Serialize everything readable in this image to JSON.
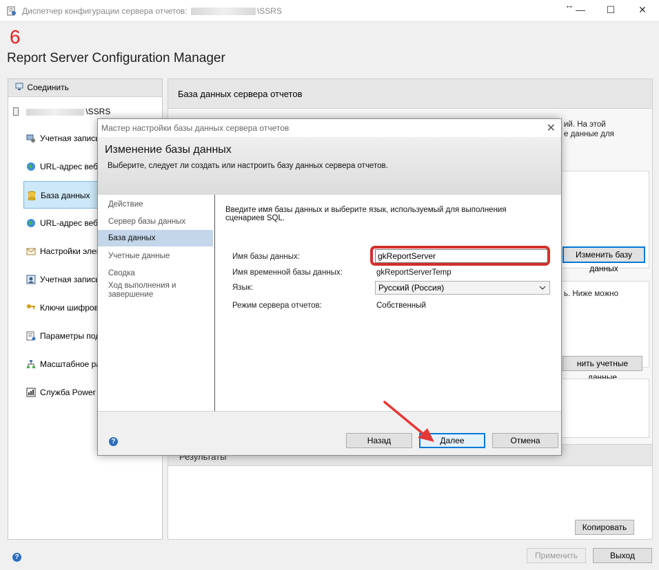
{
  "window": {
    "title_prefix": "Диспетчер конфигурации сервера отчетов:",
    "title_suffix": "\\SSRS",
    "resize_glyph": "↔",
    "minimize": "—",
    "maximize": "☐",
    "close": "✕"
  },
  "step_number": "6",
  "app_title": "Report Server Configuration Manager",
  "left_panel": {
    "connect_label": "Соединить",
    "connect_underline": "С",
    "server_suffix": "\\SSRS",
    "nav_items": [
      {
        "label": "Учетная запись службы",
        "icon": "service-account-icon"
      },
      {
        "label": "URL-адрес веб-службы",
        "icon": "web-service-url-icon"
      },
      {
        "label": "База данных",
        "icon": "database-icon"
      },
      {
        "label": "URL-адрес веб-портала",
        "icon": "web-portal-url-icon"
      },
      {
        "label": "Настройки электронной почты",
        "icon": "email-settings-icon"
      },
      {
        "label": "Учетная запись выполнения",
        "icon": "execution-account-icon"
      },
      {
        "label": "Ключи шифрования",
        "icon": "encryption-keys-icon"
      },
      {
        "label": "Параметры подписки",
        "icon": "subscription-settings-icon"
      },
      {
        "label": "Масштабное развертывание",
        "icon": "scale-out-icon"
      },
      {
        "label": "Служба Power BI",
        "icon": "power-bi-icon"
      }
    ]
  },
  "right_panel": {
    "header": "База данных сервера отчетов",
    "bg_text_1": "ий. На этой",
    "bg_text_2": "е данные для",
    "change_db_button": "Изменить базу данных",
    "bg_text_3": "ь. Ниже можно",
    "change_credentials_button": "нить учетные данные",
    "results_header": "Результаты",
    "copy_button": "Копировать"
  },
  "footer": {
    "apply_button": "Применить",
    "exit_button": "Выход",
    "help_glyph": "?"
  },
  "dialog": {
    "title": "Мастер настройки базы данных сервера отчетов",
    "close_glyph": "✕",
    "heading": "Изменение базы данных",
    "subtitle": "Выберите, следует ли создать или настроить базу данных сервера отчетов.",
    "steps": [
      "Действие",
      "Сервер базы данных",
      "База данных",
      "Учетные данные",
      "Сводка",
      "Ход выполнения и завершение"
    ],
    "intro": "Введите имя базы данных и выберите язык, используемый для выполнения сценариев SQL.",
    "db_name_label": "Имя базы данных:",
    "db_name_value": "gkReportServer",
    "temp_db_label": "Имя временной базы данных:",
    "temp_db_value": "gkReportServerTemp",
    "language_label": "Язык:",
    "language_value": "Русский (Россия)",
    "mode_label": "Режим сервера отчетов:",
    "mode_value": "Собственный",
    "back_button": "Назад",
    "next_button": "Далее",
    "cancel_button": "Отмена",
    "help_glyph": "?"
  },
  "colors": {
    "highlight": "#d3302d",
    "arrow": "#e53935",
    "accent": "#0078d7",
    "selected_nav": "#cde8f8",
    "selected_step": "#c3d6ea"
  }
}
